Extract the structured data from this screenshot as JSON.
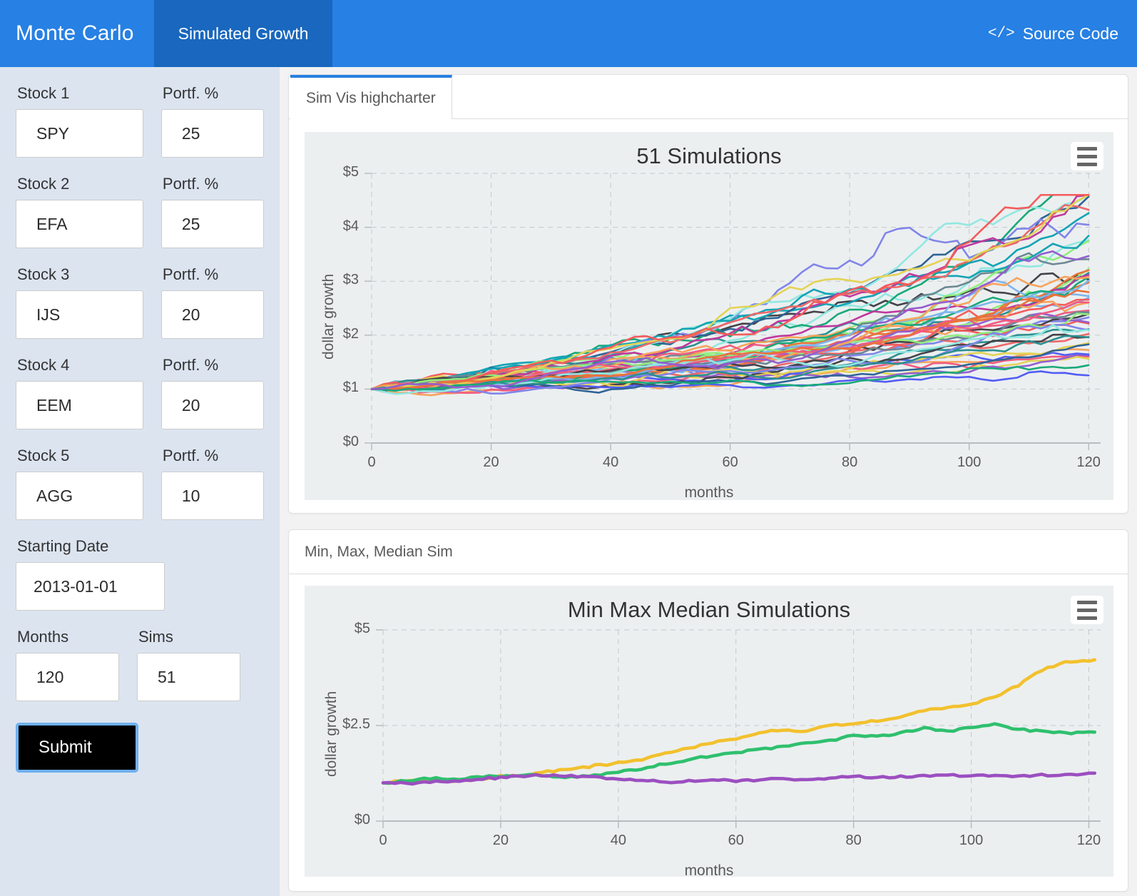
{
  "navbar": {
    "brand": "Monte Carlo",
    "tabs": [
      {
        "label": "Simulated Growth",
        "active": true
      }
    ],
    "source_code_label": "Source Code",
    "code_icon": "</>",
    "bg_color": "#2780e3",
    "active_tab_color": "#1967be"
  },
  "sidebar": {
    "bg_color": "#dce4f0",
    "stocks": [
      {
        "label": "Stock 1",
        "value": "SPY",
        "pct_label": "Portf. %",
        "pct_value": "25"
      },
      {
        "label": "Stock 2",
        "value": "EFA",
        "pct_label": "Portf. %",
        "pct_value": "25"
      },
      {
        "label": "Stock 3",
        "value": "IJS",
        "pct_label": "Portf. %",
        "pct_value": "20"
      },
      {
        "label": "Stock 4",
        "value": "EEM",
        "pct_label": "Portf. %",
        "pct_value": "20"
      },
      {
        "label": "Stock 5",
        "value": "AGG",
        "pct_label": "Portf. %",
        "pct_value": "10"
      }
    ],
    "starting_date": {
      "label": "Starting Date",
      "value": "2013-01-01"
    },
    "months": {
      "label": "Months",
      "value": "120"
    },
    "sims": {
      "label": "Sims",
      "value": "51"
    },
    "submit_label": "Submit"
  },
  "panels": [
    {
      "tab_label": "Sim Vis highcharter",
      "menu_icon": "hamburger-menu-icon"
    },
    {
      "header_label": "Min, Max, Median Sim",
      "menu_icon": "hamburger-menu-icon"
    }
  ],
  "chart_data": [
    {
      "id": "sim-vis-highcharter",
      "type": "line",
      "title": "51 Simulations",
      "xlabel": "months",
      "ylabel": "dollar growth",
      "xlim": [
        0,
        122
      ],
      "ylim": [
        0,
        5
      ],
      "xticks": [
        0,
        20,
        40,
        60,
        80,
        100,
        120
      ],
      "yticks": [
        0,
        1,
        2,
        3,
        4,
        5
      ],
      "ytick_labels": [
        "$0",
        "$1",
        "$2",
        "$3",
        "$4",
        "$5"
      ],
      "grid": true,
      "legend": "none",
      "n_series": 51,
      "start_value": 1,
      "plot_bg": "#eceff0",
      "palette": [
        "#7cb5ec",
        "#434348",
        "#90ed7d",
        "#f7a35c",
        "#8085e9",
        "#f15c80",
        "#e4d354",
        "#2b908f",
        "#f45b5b",
        "#91e8e1",
        "#e8743b",
        "#19a979",
        "#945ecf",
        "#13a4b4",
        "#525df4",
        "#bf399e",
        "#6c8893",
        "#ee6868",
        "#2f6497"
      ],
      "final_values_range": [
        1.2,
        4.4
      ],
      "description": "51 Monte Carlo simulated growth paths of $1 over 120 months, fanning out from $1 to roughly $1.2-$4.4"
    },
    {
      "id": "min-max-median-sim",
      "type": "line",
      "title": "Min Max Median Simulations",
      "xlabel": "months",
      "ylabel": "dollar growth",
      "xlim": [
        0,
        122
      ],
      "ylim": [
        0,
        5
      ],
      "xticks": [
        0,
        20,
        40,
        60,
        80,
        100,
        120
      ],
      "yticks": [
        0,
        2.5,
        5
      ],
      "ytick_labels": [
        "$0",
        "$2.5",
        "$5"
      ],
      "grid": true,
      "legend": "none",
      "plot_bg": "#eceff0",
      "series": [
        {
          "name": "max",
          "color": "#f2c12e",
          "x": [
            0,
            4,
            8,
            12,
            16,
            20,
            24,
            28,
            32,
            36,
            40,
            44,
            48,
            52,
            56,
            60,
            64,
            68,
            72,
            76,
            80,
            84,
            88,
            92,
            96,
            100,
            104,
            108,
            112,
            116,
            120
          ],
          "y": [
            1.0,
            1.05,
            1.12,
            1.05,
            1.1,
            1.18,
            1.2,
            1.3,
            1.35,
            1.45,
            1.52,
            1.62,
            1.78,
            1.9,
            2.05,
            2.15,
            2.3,
            2.4,
            2.35,
            2.5,
            2.55,
            2.62,
            2.72,
            2.9,
            2.95,
            3.05,
            3.25,
            3.55,
            3.95,
            4.15,
            4.2
          ]
        },
        {
          "name": "median",
          "color": "#2fc06e",
          "x": [
            0,
            4,
            8,
            12,
            16,
            20,
            24,
            28,
            32,
            36,
            40,
            44,
            48,
            52,
            56,
            60,
            64,
            68,
            72,
            76,
            80,
            84,
            88,
            92,
            96,
            100,
            104,
            108,
            112,
            116,
            120
          ],
          "y": [
            1.0,
            1.05,
            1.12,
            1.08,
            1.15,
            1.18,
            1.2,
            1.18,
            1.15,
            1.2,
            1.28,
            1.38,
            1.5,
            1.6,
            1.72,
            1.8,
            1.88,
            1.95,
            2.05,
            2.1,
            2.25,
            2.2,
            2.3,
            2.42,
            2.35,
            2.45,
            2.52,
            2.4,
            2.35,
            2.3,
            2.32
          ]
        },
        {
          "name": "min",
          "color": "#9b4fc0",
          "x": [
            0,
            4,
            8,
            12,
            16,
            20,
            24,
            28,
            32,
            36,
            40,
            44,
            48,
            52,
            56,
            60,
            64,
            68,
            72,
            76,
            80,
            84,
            88,
            92,
            96,
            100,
            104,
            108,
            112,
            116,
            120
          ],
          "y": [
            1.0,
            0.99,
            1.02,
            1.05,
            1.1,
            1.14,
            1.18,
            1.2,
            1.18,
            1.16,
            1.1,
            1.06,
            1.02,
            1.05,
            1.07,
            1.06,
            1.08,
            1.1,
            1.09,
            1.12,
            1.16,
            1.14,
            1.16,
            1.18,
            1.2,
            1.19,
            1.2,
            1.18,
            1.2,
            1.22,
            1.24
          ]
        }
      ]
    }
  ]
}
